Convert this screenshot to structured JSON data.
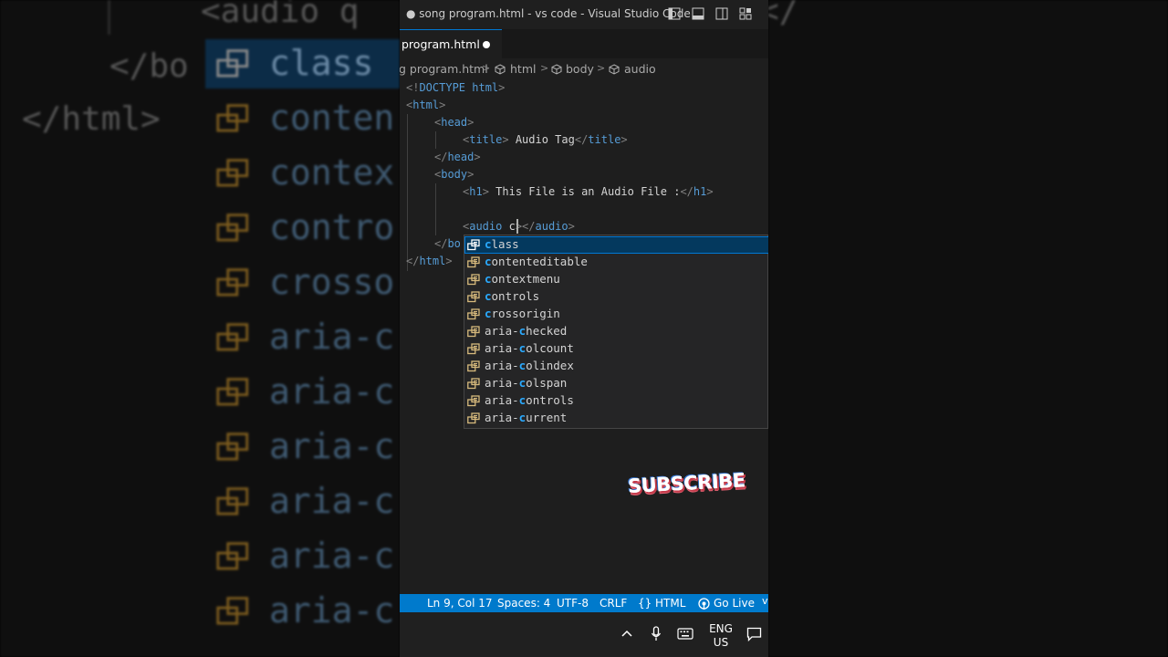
{
  "window": {
    "title": "● song program.html - vs code - Visual Studio Code",
    "tab_label": "program.html"
  },
  "breadcrumb": {
    "file": "g program.html",
    "items": [
      "html",
      "body",
      "audio"
    ]
  },
  "code_lines": {
    "l1a": "<!",
    "l1b": "DOCTYPE",
    "l1c": " html",
    "l1d": ">",
    "l2a": "<",
    "l2b": "html",
    "l2c": ">",
    "l3a": "<",
    "l3b": "head",
    "l3c": ">",
    "l4a": "<",
    "l4b": "title",
    "l4c": ">",
    "l4d": " Audio Tag",
    "l4e": "</",
    "l4f": "title",
    "l4g": ">",
    "l5a": "</",
    "l5b": "head",
    "l5c": ">",
    "l6a": "<",
    "l6b": "body",
    "l6c": ">",
    "l7a": "<",
    "l7b": "h1",
    "l7c": ">",
    "l7d": " This File is an Audio File :",
    "l7e": "</",
    "l7f": "h1",
    "l7g": ">",
    "l9a": "<",
    "l9b": "audio",
    "l9c": " c",
    "l9d": "></",
    "l9e": "audio",
    "l9f": ">",
    "l10a": "</",
    "l10b": "bo",
    "l11a": "</",
    "l11b": "html",
    "l11c": ">"
  },
  "suggestions": [
    {
      "pre": "",
      "match": "c",
      "post": "lass"
    },
    {
      "pre": "",
      "match": "c",
      "post": "ontenteditable"
    },
    {
      "pre": "",
      "match": "c",
      "post": "ontextmenu"
    },
    {
      "pre": "",
      "match": "c",
      "post": "ontrols"
    },
    {
      "pre": "",
      "match": "c",
      "post": "rossorigin"
    },
    {
      "pre": "aria-",
      "match": "c",
      "post": "hecked"
    },
    {
      "pre": "aria-",
      "match": "c",
      "post": "olcount"
    },
    {
      "pre": "aria-",
      "match": "c",
      "post": "olindex"
    },
    {
      "pre": "aria-",
      "match": "c",
      "post": "olspan"
    },
    {
      "pre": "aria-",
      "match": "c",
      "post": "ontrols"
    },
    {
      "pre": "aria-",
      "match": "c",
      "post": "urrent"
    }
  ],
  "overlay": {
    "subscribe": "SUBSCRIBE"
  },
  "status_bar": {
    "position": "Ln 9, Col 17",
    "spaces": "Spaces: 4",
    "encoding": "UTF-8",
    "eol": "CRLF",
    "language": "HTML",
    "live": "Go Live"
  },
  "taskbar": {
    "lang1": "ENG",
    "lang2": "US"
  },
  "background": {
    "top_text": "<audio q",
    "close_body": "</bo",
    "close_html": "</html>",
    "items": [
      "class",
      "conten",
      "contex",
      "contro",
      "crosso",
      "aria-c",
      "aria-c",
      "aria-c",
      "aria-c",
      "aria-c",
      "aria-c"
    ],
    "right_top": "</"
  },
  "colors": {
    "accent": "#007acc",
    "tag": "#569cd6",
    "match": "#2aaaff",
    "suggest_icon": "#d7ba7d"
  },
  "icons": [
    "layout-sidebar-icon",
    "layout-panel-icon",
    "layout-secondary-icon",
    "customize-layout-icon",
    "symbol-property-icon",
    "chevron-up-icon",
    "mic-icon",
    "keyboard-icon",
    "notification-icon",
    "broadcast-icon",
    "braces-icon"
  ]
}
